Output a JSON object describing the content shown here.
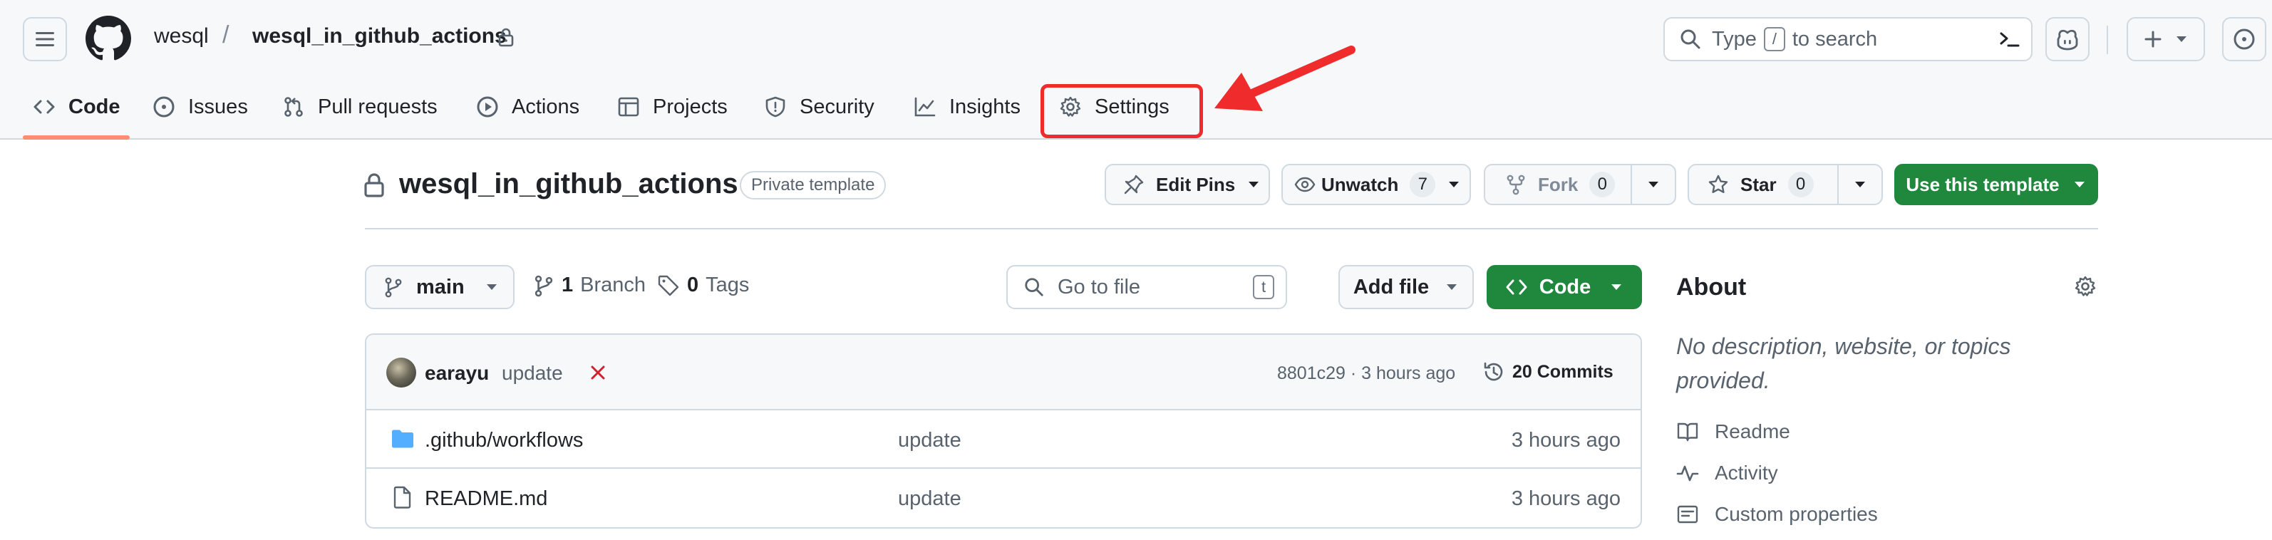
{
  "header": {
    "owner": "wesql",
    "separator": "/",
    "repo": "wesql_in_github_actions",
    "search": {
      "prefix": "Type",
      "key": "/",
      "suffix": "to search"
    }
  },
  "nav": [
    {
      "label": "Code",
      "icon": "code-icon",
      "active": true
    },
    {
      "label": "Issues",
      "icon": "issue-opened-icon"
    },
    {
      "label": "Pull requests",
      "icon": "git-pull-request-icon"
    },
    {
      "label": "Actions",
      "icon": "play-icon"
    },
    {
      "label": "Projects",
      "icon": "table-icon"
    },
    {
      "label": "Security",
      "icon": "shield-icon"
    },
    {
      "label": "Insights",
      "icon": "graph-icon"
    },
    {
      "label": "Settings",
      "icon": "gear-icon",
      "highlighted": true
    }
  ],
  "repo_header": {
    "title": "wesql_in_github_actions",
    "badge": "Private template",
    "edit_pins": "Edit Pins",
    "unwatch": "Unwatch",
    "watch_count": "7",
    "fork": "Fork",
    "fork_count": "0",
    "star": "Star",
    "star_count": "0",
    "use_template": "Use this template"
  },
  "browser": {
    "branch": "main",
    "branch_count": "1",
    "branch_label": "Branch",
    "tag_count": "0",
    "tag_label": "Tags",
    "goto_placeholder": "Go to file",
    "goto_key": "t",
    "add_file": "Add file",
    "code": "Code",
    "commit": {
      "author": "earayu",
      "message": "update",
      "meta": "8801c29 · 3 hours ago",
      "commits": "20 Commits"
    },
    "files": [
      {
        "name": ".github/workflows",
        "type": "folder",
        "message": "update",
        "time": "3 hours ago"
      },
      {
        "name": "README.md",
        "type": "file",
        "message": "update",
        "time": "3 hours ago"
      }
    ]
  },
  "about": {
    "title": "About",
    "description": "No description, website, or topics provided.",
    "links": [
      {
        "label": "Readme",
        "icon": "book-icon"
      },
      {
        "label": "Activity",
        "icon": "pulse-icon"
      },
      {
        "label": "Custom properties",
        "icon": "note-icon"
      }
    ]
  },
  "colors": {
    "primary_green": "#1f883d",
    "active_underline": "#fd8c73",
    "annotation_red": "#ef2b2b",
    "folder_blue": "#54aeff",
    "muted_text": "#59636e"
  }
}
